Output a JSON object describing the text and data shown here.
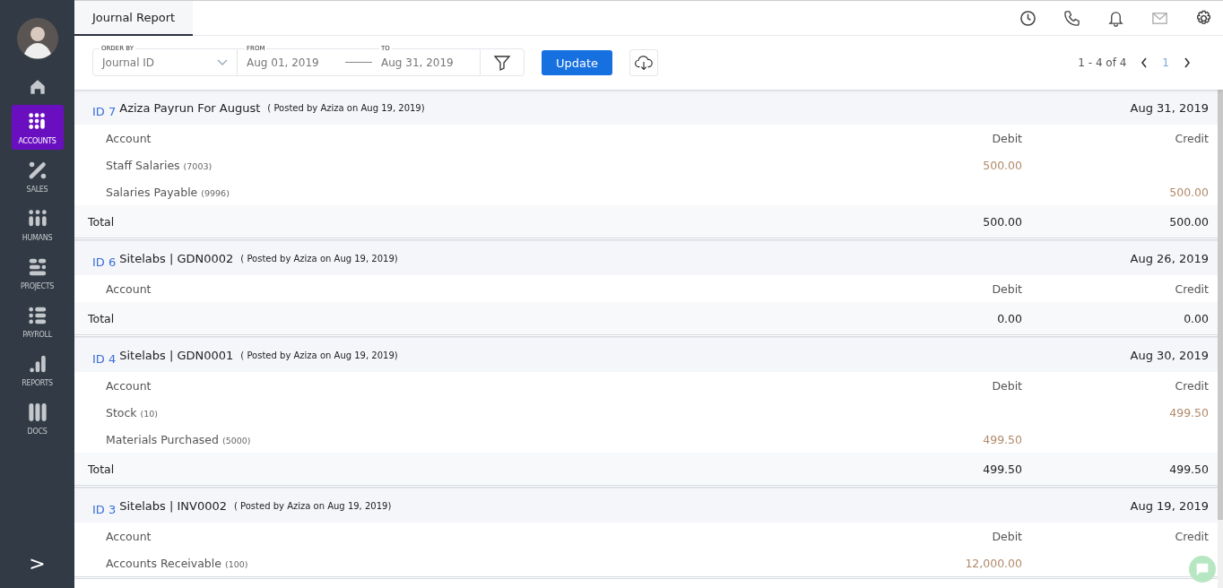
{
  "sidebar": {
    "items": [
      {
        "kind": "home",
        "selected": false
      },
      {
        "kind": "accounts",
        "label": "ACCOUNTS",
        "selected": true
      },
      {
        "kind": "sales",
        "label": "SALES",
        "selected": false
      },
      {
        "kind": "humans",
        "label": "HUMANS",
        "selected": false
      },
      {
        "kind": "projects",
        "label": "PROJECTS",
        "selected": false
      },
      {
        "kind": "payroll",
        "label": "PAYROLL",
        "selected": false
      },
      {
        "kind": "reports",
        "label": "REPORTS",
        "selected": false
      },
      {
        "kind": "docs",
        "label": "DOCS",
        "selected": false
      }
    ],
    "expand": ">"
  },
  "tabs": [
    {
      "label": "Journal Report",
      "selected": true
    }
  ],
  "toolbar": {
    "order_by": {
      "label": "ORDER BY",
      "value": "Journal ID"
    },
    "from": {
      "label": "FROM",
      "value": "Aug 01, 2019"
    },
    "to": {
      "label": "TO",
      "value": "Aug 31, 2019"
    },
    "update": "Update"
  },
  "pagination": {
    "range": "1 - 4 of 4",
    "page": "1"
  },
  "journals": [
    {
      "id": "ID 7",
      "title": "Aziza Payrun For August",
      "posted": "( Posted by Aziza on Aug 19, 2019)",
      "date": "Aug 31, 2019",
      "columns": [
        "Account",
        "Debit",
        "Credit"
      ],
      "lines": [
        {
          "account": "Staff Salaries",
          "code": "(7003)",
          "debit": "500.00"
        },
        {
          "account": "Salaries Payable",
          "code": "(9996)",
          "credit": "500.00"
        }
      ],
      "total": {
        "label": "Total",
        "debit": "500.00",
        "credit": "500.00"
      }
    },
    {
      "id": "ID 6",
      "title": "Sitelabs | GDN0002",
      "posted": "( Posted by Aziza on Aug 19, 2019)",
      "date": "Aug 26, 2019",
      "columns": [
        "Account",
        "Debit",
        "Credit"
      ],
      "total": {
        "label": "Total",
        "debit": "0.00",
        "credit": "0.00"
      }
    },
    {
      "id": "ID 4",
      "title": "Sitelabs | GDN0001",
      "posted": "( Posted by Aziza on Aug 19, 2019)",
      "date": "Aug 30, 2019",
      "columns": [
        "Account",
        "Debit",
        "Credit"
      ],
      "lines": [
        {
          "account": "Stock",
          "code": "(10)",
          "credit": "499.50"
        },
        {
          "account": "Materials Purchased",
          "code": "(5000)",
          "debit": "499.50"
        }
      ],
      "total": {
        "label": "Total",
        "debit": "499.50",
        "credit": "499.50"
      }
    },
    {
      "id": "ID 3",
      "title": "Sitelabs | INV0002",
      "posted": "( Posted by Aziza on Aug 19, 2019)",
      "date": "Aug 19, 2019",
      "columns": [
        "Account",
        "Debit",
        "Credit"
      ],
      "lines": [
        {
          "account": "Accounts Receivable",
          "code": "(100)",
          "debit": "12,000.00"
        }
      ]
    }
  ]
}
